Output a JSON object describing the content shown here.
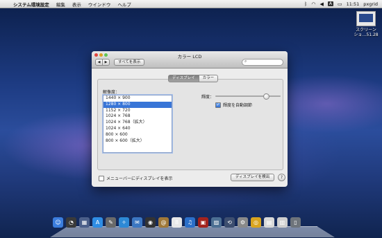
{
  "menubar": {
    "app_name": "システム環境設定",
    "items": [
      "編集",
      "表示",
      "ウインドウ",
      "ヘルプ"
    ],
    "time": "11:51",
    "user": "pxgrid",
    "input_flag": "A"
  },
  "desktop_file": {
    "line1": "スクリーン",
    "line2": "ショ…51.28"
  },
  "window": {
    "title": "カラー LCD",
    "show_all_label": "すべてを表示",
    "search_placeholder": "",
    "tabs": [
      "ディスプレイ",
      "カラー"
    ],
    "resolution_label": "解像度：",
    "resolutions": [
      "1440 × 900",
      "1280 × 800",
      "1152 × 720",
      "1024 × 768",
      "1024 × 768（拡大）",
      "1024 × 640",
      "800 × 600",
      "800 × 600（拡大）"
    ],
    "selected_resolution": 1,
    "brightness_label": "輝度：",
    "brightness_value": 0.78,
    "auto_brightness_label": "輝度を自動調節",
    "auto_brightness_checked": true,
    "menubar_option_label": "メニューバーにディスプレイを表示",
    "menubar_option_checked": false,
    "detect_button_label": "ディスプレイを検出",
    "help_label": "?"
  },
  "dock": {
    "icons": [
      {
        "name": "finder-icon",
        "color": "#3b7ddd",
        "glyph": "☺"
      },
      {
        "name": "dashboard-icon",
        "color": "#3a3a3a",
        "glyph": "◔"
      },
      {
        "name": "mission-control-icon",
        "color": "#4b5f8a",
        "glyph": "▦"
      },
      {
        "name": "app-store-icon",
        "color": "#2f8de4",
        "glyph": "A"
      },
      {
        "name": "preview-icon",
        "color": "#6a6a6a",
        "glyph": "✎"
      },
      {
        "name": "safari-icon",
        "color": "#2d89d6",
        "glyph": "✧"
      },
      {
        "name": "mail-icon",
        "color": "#3c77c2",
        "glyph": "✉"
      },
      {
        "name": "facetime-icon",
        "color": "#333",
        "glyph": "◉"
      },
      {
        "name": "address-book-icon",
        "color": "#a07838",
        "glyph": "@"
      },
      {
        "name": "ical-icon",
        "color": "#e8e8e8",
        "glyph": "8"
      },
      {
        "name": "itunes-icon",
        "color": "#2b6fc9",
        "glyph": "♫"
      },
      {
        "name": "photo-booth-icon",
        "color": "#a3231e",
        "glyph": "▣"
      },
      {
        "name": "iphoto-icon",
        "color": "#4c6f93",
        "glyph": "▨"
      },
      {
        "name": "time-machine-icon",
        "color": "#3d4e6f",
        "glyph": "⟲"
      },
      {
        "name": "system-preferences-icon",
        "color": "#8a8a8a",
        "glyph": "⚙"
      },
      {
        "name": "chrome-icon",
        "color": "#d9a41f",
        "glyph": "◎"
      },
      {
        "name": "documents-icon",
        "color": "#d8d8d8",
        "glyph": "▤"
      },
      {
        "name": "downloads-icon",
        "color": "#cfcfcf",
        "glyph": "▥"
      },
      {
        "name": "trash-icon",
        "color": "#6e747b",
        "glyph": "▯"
      }
    ]
  }
}
